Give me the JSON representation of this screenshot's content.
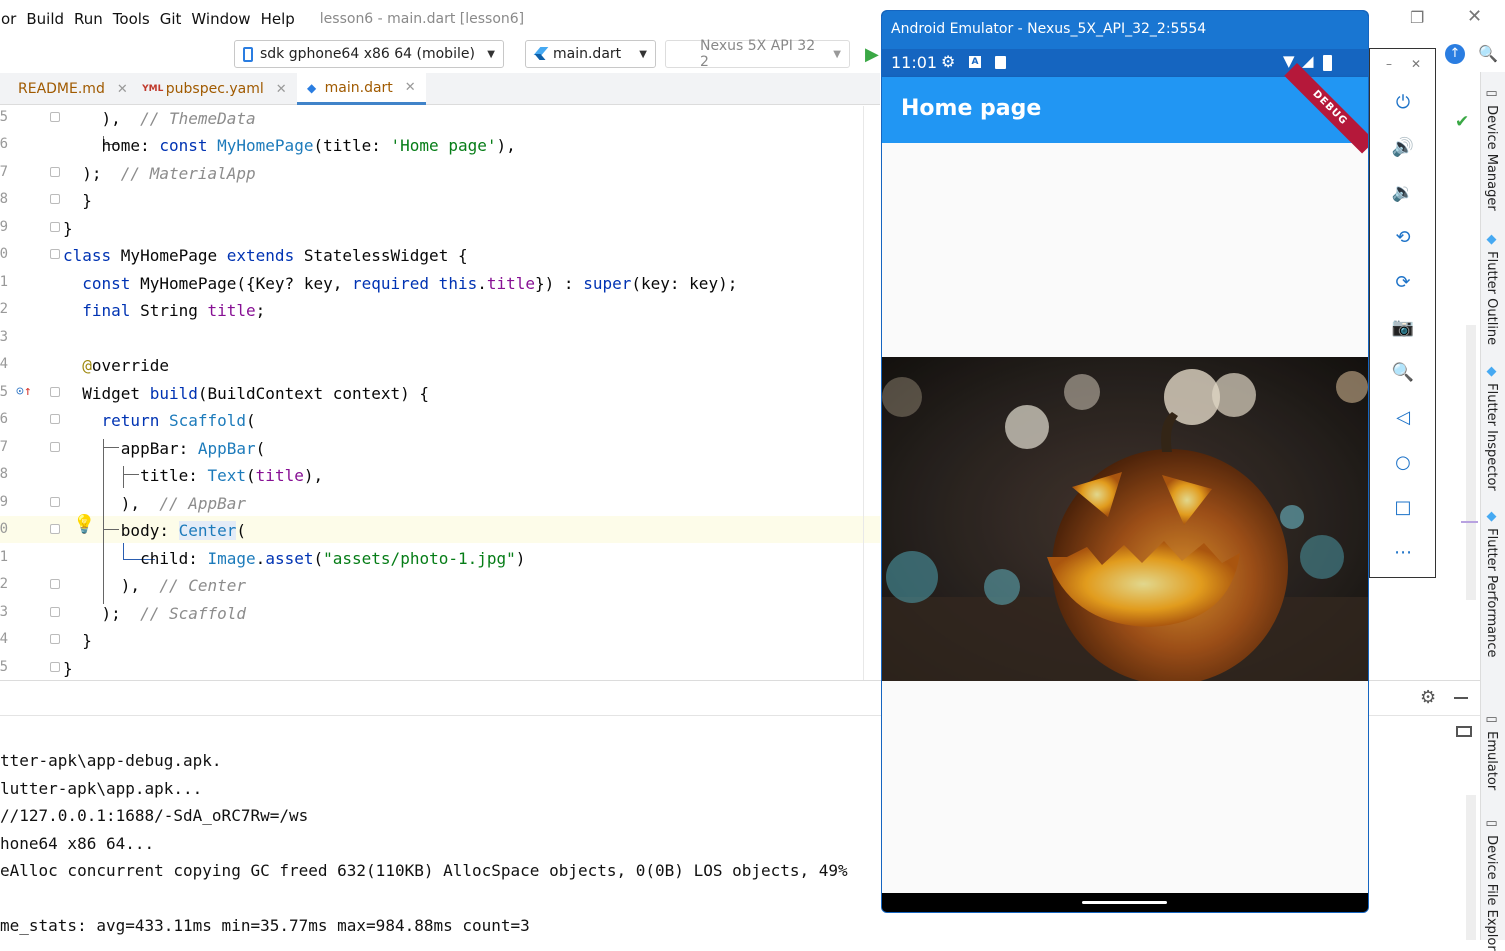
{
  "menu": {
    "items": [
      "or",
      "Build",
      "Run",
      "Tools",
      "Git",
      "Window",
      "Help"
    ],
    "window_title": "lesson6 - main.dart [lesson6]"
  },
  "toolbar": {
    "device": "sdk gphone64 x86 64 (mobile)",
    "run_config": "main.dart",
    "avd": "Nexus 5X API 32 2"
  },
  "tabs": [
    {
      "label": "README.md",
      "icon": "markdown-icon"
    },
    {
      "label": "pubspec.yaml",
      "icon": "yaml-icon"
    },
    {
      "label": "main.dart",
      "icon": "dart-icon"
    }
  ],
  "editor": {
    "line_numbers": [
      "5",
      "6",
      "7",
      "8",
      "9",
      "0",
      "1",
      "2",
      "3",
      "4",
      "5",
      "6",
      "7",
      "8",
      "9",
      "0",
      "1",
      "2",
      "3",
      "4",
      "5"
    ],
    "lines": [
      "    ),  // ThemeData",
      "    home: const MyHomePage(title: 'Home page'),",
      "  );  // MaterialApp",
      "  }",
      "}",
      "class MyHomePage extends StatelessWidget {",
      "  const MyHomePage({Key? key, required this.title}) : super(key: key);",
      "  final String title;",
      "",
      "  @override",
      "  Widget build(BuildContext context) {",
      "    return Scaffold(",
      "      appBar: AppBar(",
      "        title: Text(title),",
      "      ),  // AppBar",
      "      body: Center(",
      "        child: Image.asset(\"assets/photo-1.jpg\")",
      "      ),  // Center",
      "    );  // Scaffold",
      "  }",
      "}"
    ]
  },
  "console": {
    "lines": [
      "tter-apk\\app-debug.apk.",
      "lutter-apk\\app.apk...",
      "//127.0.0.1:1688/-SdA_oRC7Rw=/ws",
      "hone64 x86 64...",
      "eAlloc concurrent copying GC freed 632(110KB) AllocSpace objects, 0(0B) LOS objects, 49%",
      "",
      "me_stats: avg=433.11ms min=35.77ms max=984.88ms count=3"
    ]
  },
  "right_tools": [
    "Device Manager",
    "Flutter Outline",
    "Flutter Inspector",
    "Flutter Performance",
    "Emulator",
    "Device File Explor"
  ],
  "emulator": {
    "title": "Android Emulator - Nexus_5X_API_32_2:5554",
    "time": "11:01",
    "debug_banner": "DEBUG",
    "app_title": "Home page",
    "image_alt": "jack-o-lantern pumpkin photo",
    "side_buttons": [
      "power-icon",
      "volume-up-icon",
      "volume-down-icon",
      "rotate-left-icon",
      "rotate-right-icon",
      "camera-icon",
      "zoom-icon",
      "back-icon",
      "home-icon",
      "overview-icon",
      "more-icon"
    ],
    "colors": {
      "title_bar": "#1976d2",
      "status_bar": "#1565c0",
      "app_bar": "#2196f3"
    }
  }
}
